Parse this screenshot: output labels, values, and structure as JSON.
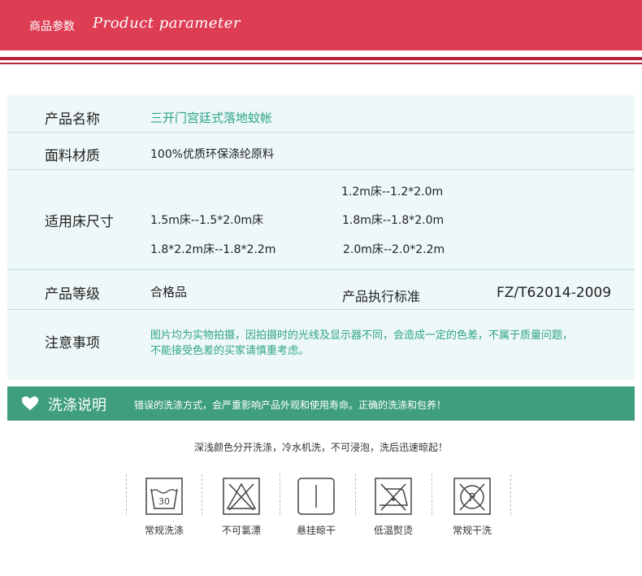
{
  "header": {
    "title_cn": "商品参数",
    "title_en": "Product parameter"
  },
  "params": {
    "name": {
      "label": "产品名称",
      "value": "三开门宫廷式落地蚊帐"
    },
    "material": {
      "label": "面料材质",
      "value": "100%优质环保涤纶原料"
    },
    "bed_size": {
      "label": "适用床尺寸",
      "sizes": [
        "1.2m床--1.2*2.0m",
        "1.5m床--1.5*2.0m床",
        "1.8m床--1.8*2.0m",
        "1.8*2.2m床--1.8*2.2m",
        "2.0m床--2.0*2.2m"
      ]
    },
    "grade": {
      "label": "产品等级",
      "value": "合格品",
      "standard_label": "产品执行标准",
      "standard_value": "FZ/T62014-2009"
    },
    "notice": {
      "label": "注意事项",
      "lines": [
        "图片均为实物拍摄，因拍摄时的光线及显示器不同，会造成一定的色差，不属于质量问题，",
        "不能接受色差的买家请慎重考虑。"
      ]
    }
  },
  "wash": {
    "title": "洗涤说明",
    "description": "错误的洗涤方式，会严重影响产品外观和使用寿命。正确的洗涤和包养！",
    "tip": "深浅颜色分开洗涤，冷水机洗，不可浸泡，洗后迅速晾起！",
    "icons": [
      {
        "icon": "wash-30-icon",
        "label": "常规洗涤",
        "temp": "30"
      },
      {
        "icon": "no-bleach-icon",
        "label": "不可氯漂"
      },
      {
        "icon": "hang-dry-icon",
        "label": "悬挂晾干"
      },
      {
        "icon": "low-iron-icon",
        "label": "低温熨烫"
      },
      {
        "icon": "dry-clean-icon",
        "label": "常规干洗",
        "letter": "P"
      }
    ]
  },
  "colors": {
    "header": "#dd3e54",
    "stripe": "#b5223d",
    "table_bg": "#eef8f8",
    "accent_green": "#2fa48a",
    "wash_bar": "#3f9f7c"
  }
}
